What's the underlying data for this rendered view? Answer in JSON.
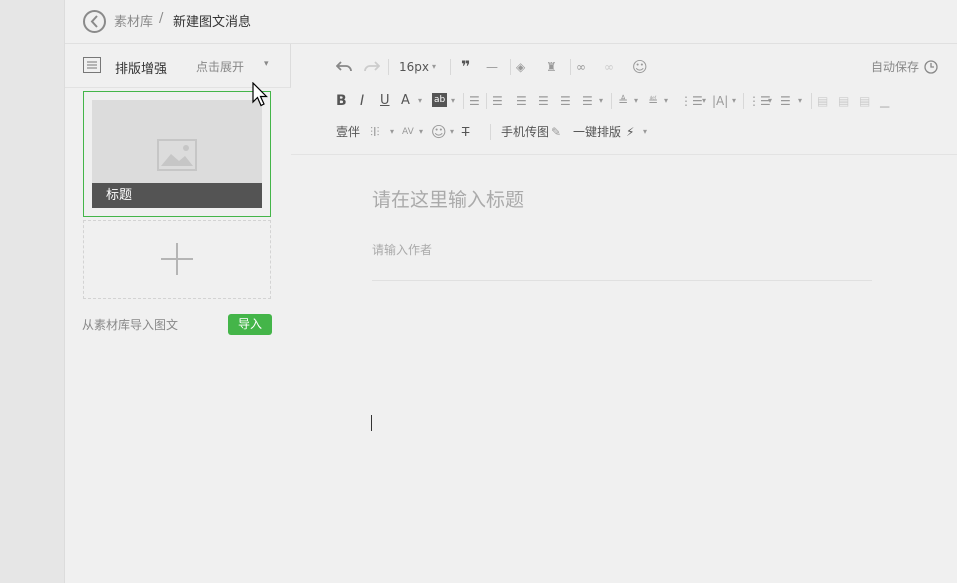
{
  "breadcrumb": {
    "parent": "素材库",
    "separator": "/",
    "current": "新建图文消息"
  },
  "left_panel": {
    "title": "排版增强",
    "expand_label": "点击展开",
    "caret": "▾",
    "article_card_title": "标题",
    "import_label": "从素材库导入图文",
    "import_button": "导入"
  },
  "toolbar": {
    "font_size": "16px",
    "font_size_caret": "▾",
    "autosave": "自动保存",
    "row3": {
      "lineheight_label": "壹伴",
      "phone_upload": "手机传图",
      "one_click_layout": "一键排版"
    }
  },
  "editor": {
    "title_placeholder": "请在这里输入标题",
    "author_placeholder": "请输入作者"
  },
  "colors": {
    "accent_green": "#44b549",
    "background": "#f0f0f0"
  }
}
